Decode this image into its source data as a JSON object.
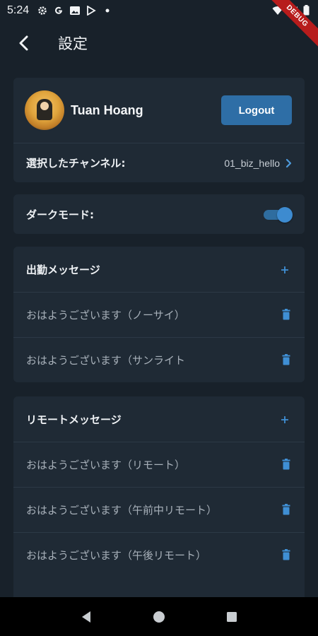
{
  "status_bar": {
    "time": "5:24",
    "debug_label": "DEBUG"
  },
  "app_bar": {
    "title": "設定"
  },
  "profile": {
    "name": "Tuan Hoang",
    "logout_label": "Logout"
  },
  "channel": {
    "label": "選択したチャンネル:",
    "value": "01_biz_hello"
  },
  "dark_mode": {
    "label": "ダークモード:",
    "enabled": true
  },
  "attendance": {
    "header": "出勤メッセージ",
    "items": [
      "おはようございます（ノーサイ）",
      "おはようございます（サンライト"
    ]
  },
  "remote": {
    "header": "リモートメッセージ",
    "items": [
      "おはようございます（リモート）",
      "おはようございます（午前中リモート）",
      "おはようございます（午後リモート）"
    ]
  },
  "colors": {
    "background": "#18212a",
    "card": "#1f2a35",
    "accent": "#2e6ea6",
    "icon_accent": "#3f8fd4"
  }
}
